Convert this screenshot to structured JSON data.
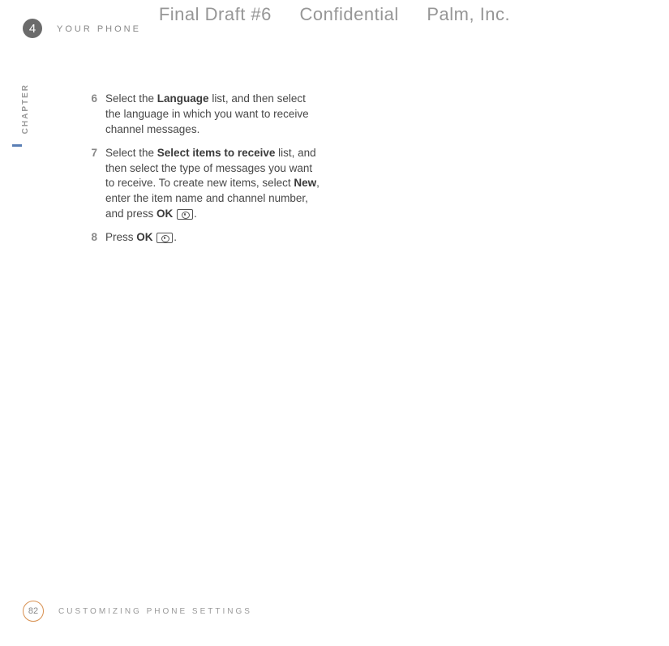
{
  "watermark": {
    "draft": "Final Draft #6",
    "confidential": "Confidential",
    "company": "Palm, Inc."
  },
  "header": {
    "chapter_number": "4",
    "section_title": "YOUR PHONE",
    "chapter_label": "CHAPTER"
  },
  "steps": [
    {
      "num": "6",
      "segments": [
        {
          "t": "Select the "
        },
        {
          "t": "Language",
          "b": true
        },
        {
          "t": " list, and then select the language in which you want to receive channel messages."
        }
      ]
    },
    {
      "num": "7",
      "segments": [
        {
          "t": "Select the "
        },
        {
          "t": "Select items to receive",
          "b": true
        },
        {
          "t": " list, and then select the type of messages you want to receive. To create new items, select "
        },
        {
          "t": "New",
          "b": true
        },
        {
          "t": ", enter the item name and channel number, and press "
        },
        {
          "t": "OK",
          "b": true
        },
        {
          "t": " ",
          "icon": true
        },
        {
          "t": "."
        }
      ]
    },
    {
      "num": "8",
      "segments": [
        {
          "t": "Press "
        },
        {
          "t": "OK",
          "b": true
        },
        {
          "t": " ",
          "icon": true
        },
        {
          "t": "."
        }
      ]
    }
  ],
  "footer": {
    "page_number": "82",
    "section_title": "CUSTOMIZING PHONE SETTINGS"
  }
}
